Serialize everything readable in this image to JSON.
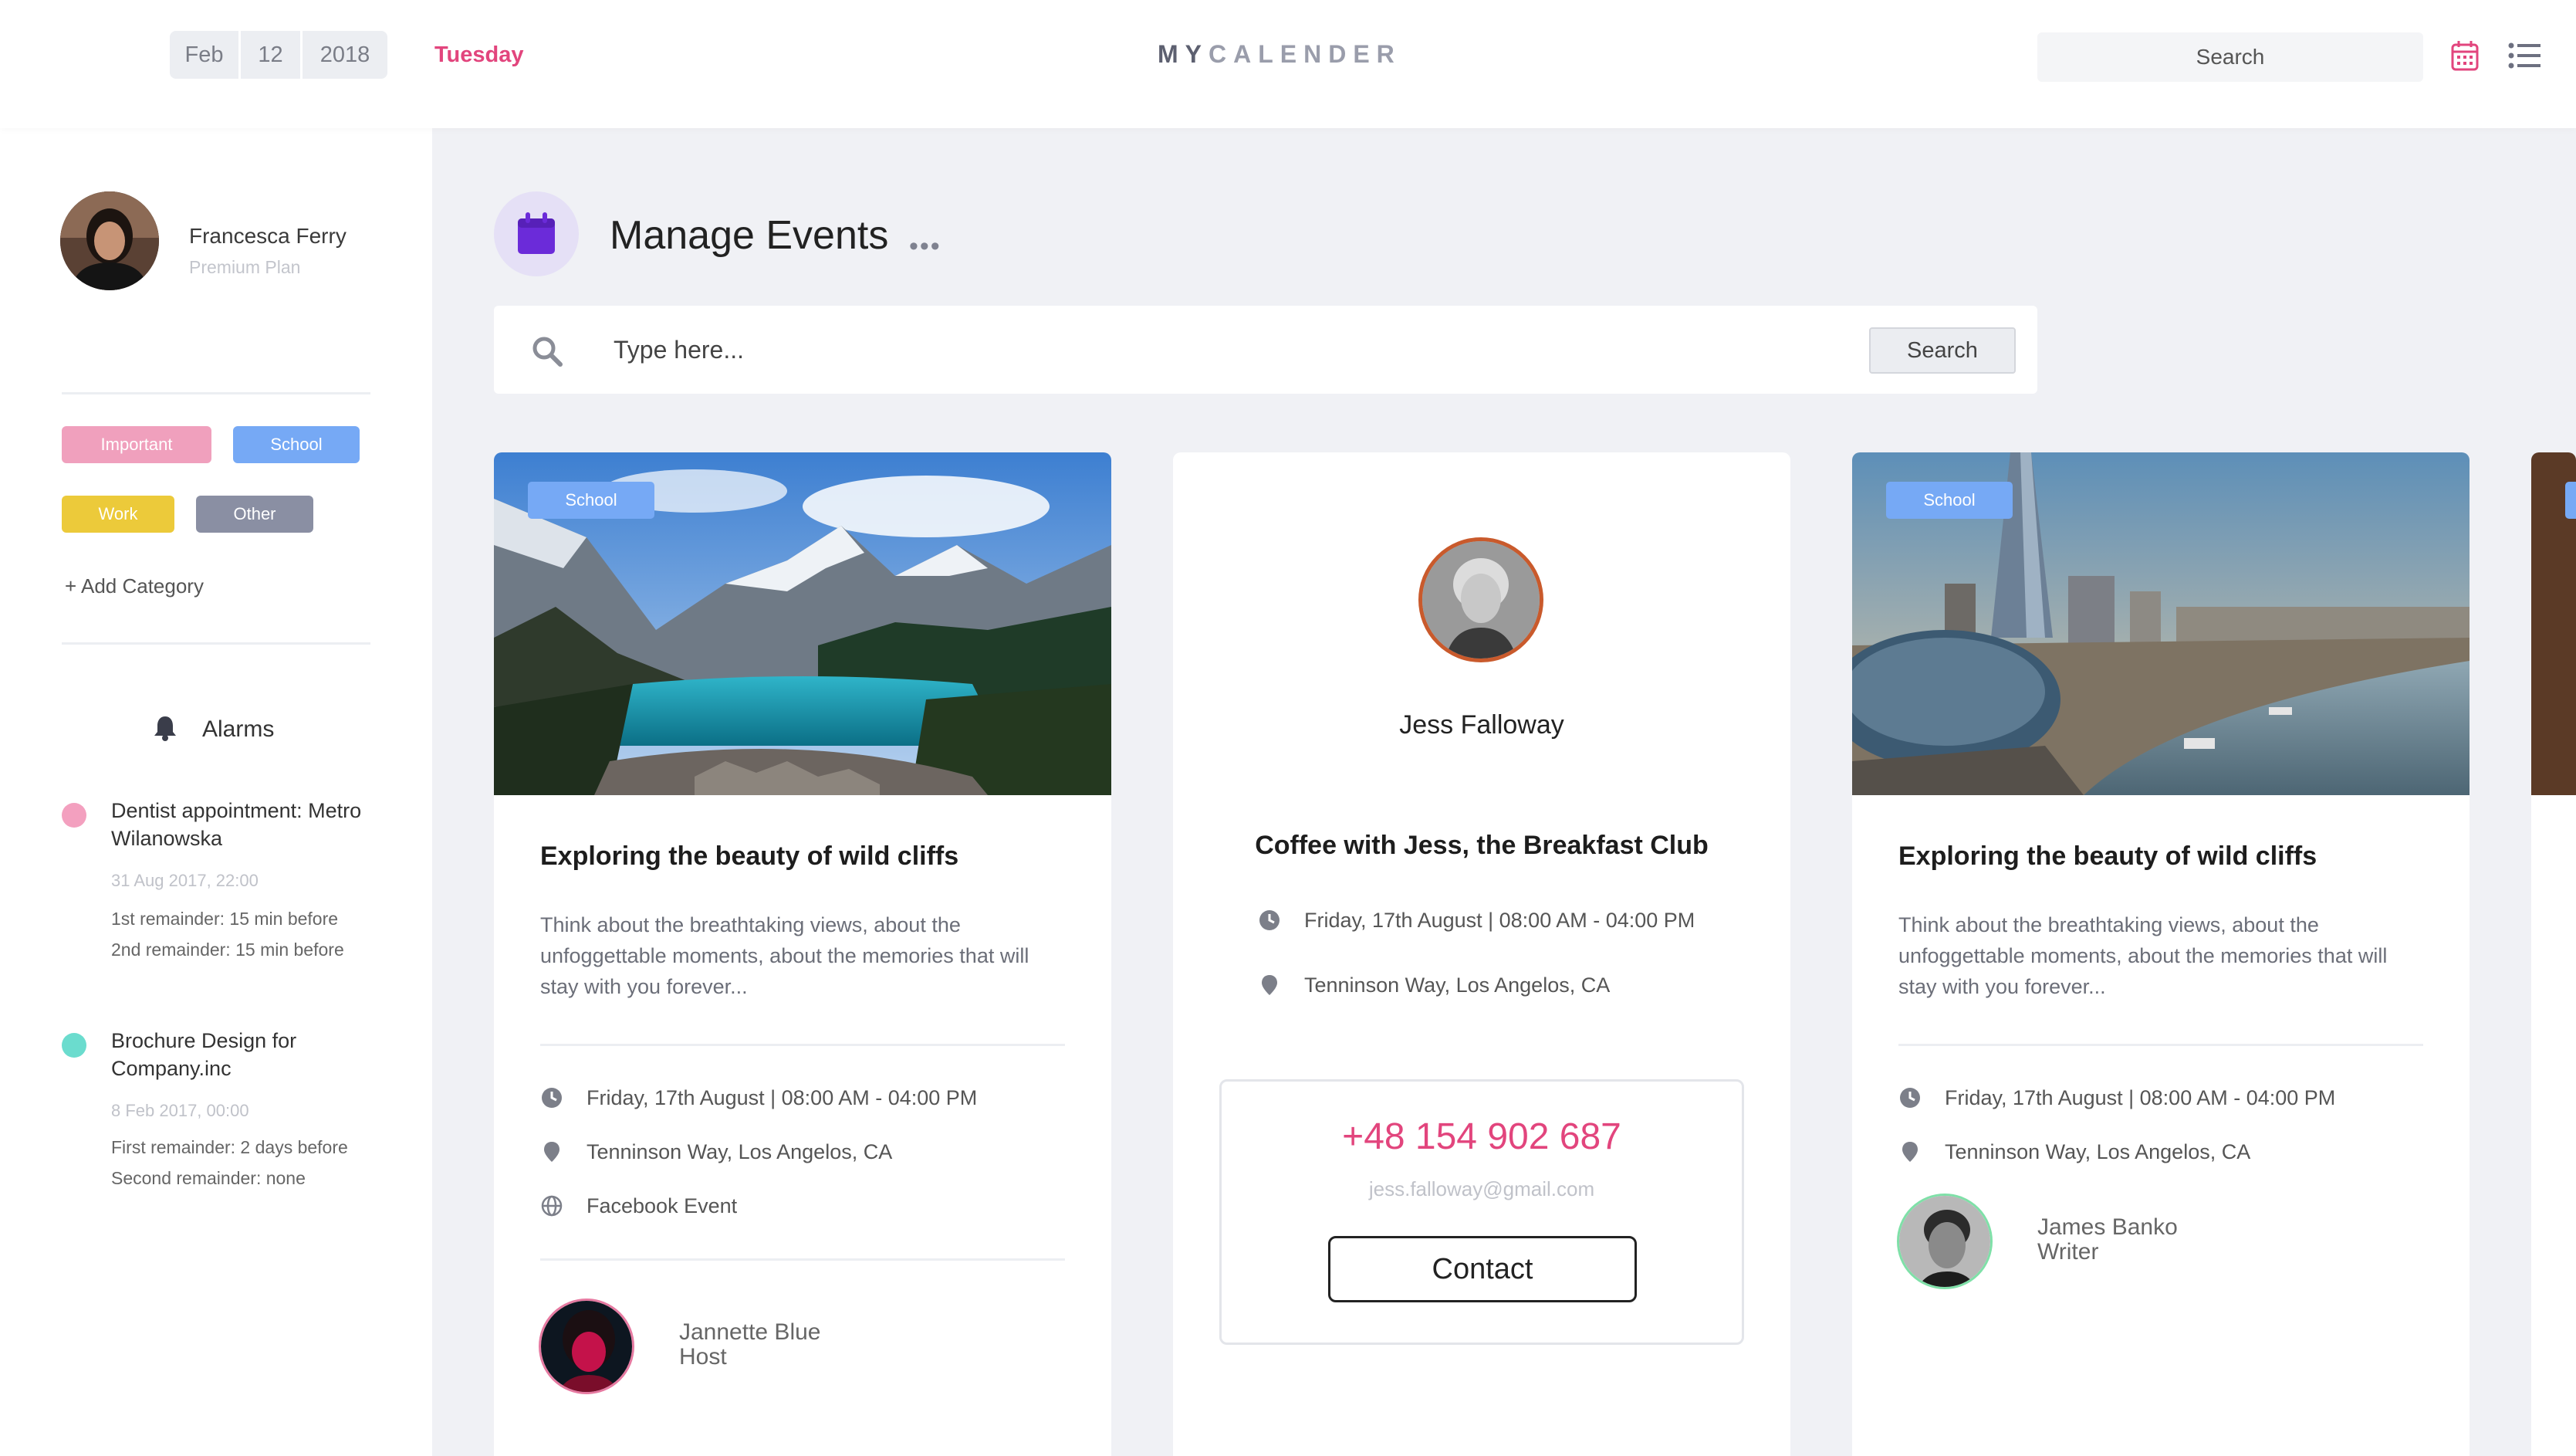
{
  "header": {
    "date": {
      "month": "Feb",
      "day": "12",
      "year": "2018"
    },
    "weekday": "Tuesday",
    "brand_bold": "MY",
    "brand_light": "CALENDER",
    "search_label": "Search",
    "accent_color": "#e2457d",
    "icons": [
      "calendar-icon",
      "list-icon"
    ]
  },
  "sidebar": {
    "user": {
      "name": "Francesca Ferry",
      "plan": "Premium Plan"
    },
    "categories": [
      {
        "label": "Important",
        "color": "#f0a0bd"
      },
      {
        "label": "School",
        "color": "#76a9f5"
      },
      {
        "label": "Work",
        "color": "#ecca3a"
      },
      {
        "label": "Other",
        "color": "#8a8fa3"
      }
    ],
    "add_category": "+ Add Category",
    "alarms_title": "Alarms",
    "alarms": [
      {
        "title": "Dentist appointment: Metro Wilanowska",
        "date": "31 Aug 2017, 22:00",
        "reminders": [
          "1st remainder: 15 min before",
          "2nd remainder: 15 min before"
        ],
        "color": "#f3a0bf"
      },
      {
        "title": "Brochure Design for Company.inc",
        "date": "8 Feb 2017, 00:00",
        "reminders": [
          "First remainder: 2 days before",
          "Second remainder: none"
        ],
        "color": "#6bdcce"
      }
    ]
  },
  "main": {
    "title": "Manage Events",
    "more": "•••",
    "search": {
      "placeholder": "Type here...",
      "button": "Search"
    },
    "cards": [
      {
        "tag": "School",
        "title": "Exploring the beauty of wild cliffs",
        "description": "Think about the breathtaking views, about the unfoggettable moments, about the memories that will stay with you forever...",
        "time": "Friday, 17th August | 08:00 AM - 04:00 PM",
        "location": "Tenninson Way, Los Angelos, CA",
        "link": "Facebook Event",
        "person": {
          "name": "Jannette Blue",
          "role": "Host"
        }
      },
      {
        "name": "Jess Falloway",
        "title": "Coffee with Jess, the Breakfast Club",
        "time": "Friday, 17th August | 08:00 AM - 04:00 PM",
        "location": "Tenninson Way, Los Angelos, CA",
        "phone": "+48 154 902 687",
        "email": "jess.falloway@gmail.com",
        "button": "Contact"
      },
      {
        "tag": "School",
        "title": "Exploring the beauty of wild cliffs",
        "description": "Think about the breathtaking views, about the unfoggettable moments, about the memories that will stay with you forever...",
        "time": "Friday, 17th August | 08:00 AM - 04:00 PM",
        "location": "Tenninson Way, Los Angelos, CA",
        "person": {
          "name": "James Banko",
          "role": "Writer"
        }
      }
    ]
  }
}
